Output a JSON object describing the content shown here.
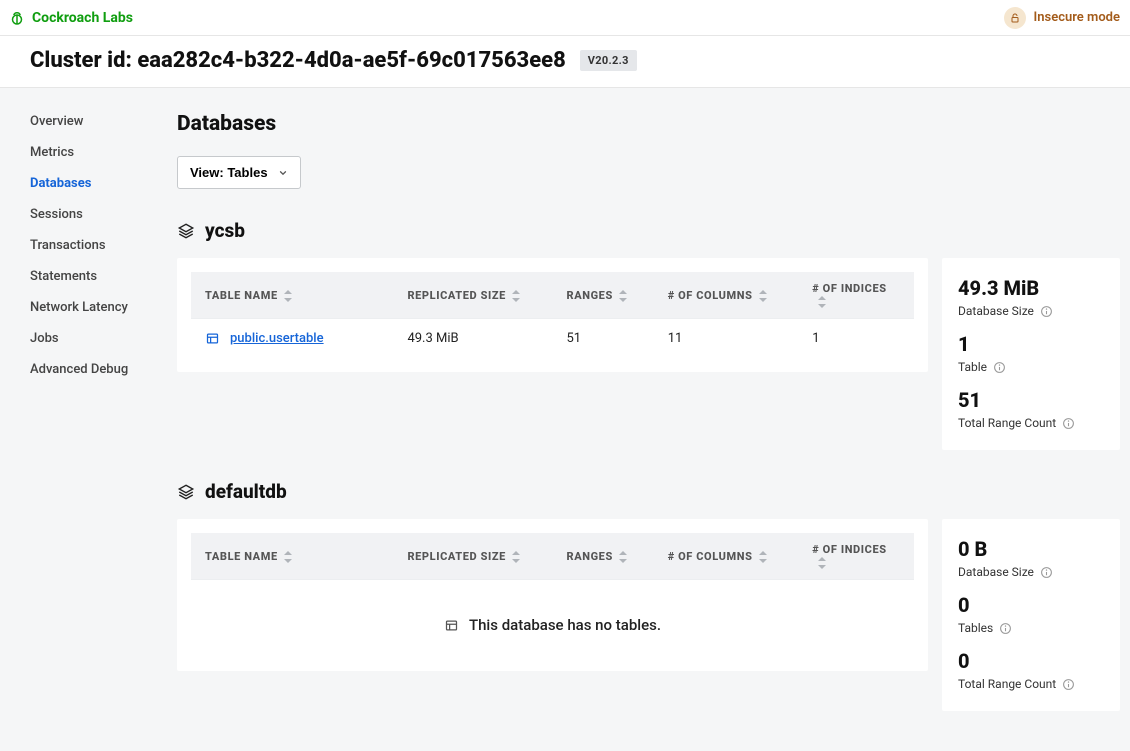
{
  "brand": "Cockroach Labs",
  "insecure_label": "Insecure mode",
  "cluster": {
    "prefix": "Cluster id: ",
    "id": "eaa282c4-b322-4d0a-ae5f-69c017563ee8",
    "version": "V20.2.3"
  },
  "sidebar": {
    "items": [
      {
        "label": "Overview"
      },
      {
        "label": "Metrics"
      },
      {
        "label": "Databases",
        "active": true
      },
      {
        "label": "Sessions"
      },
      {
        "label": "Transactions"
      },
      {
        "label": "Statements"
      },
      {
        "label": "Network Latency"
      },
      {
        "label": "Jobs"
      },
      {
        "label": "Advanced Debug"
      }
    ]
  },
  "page": {
    "title": "Databases",
    "view_button": "View: Tables"
  },
  "columns": {
    "name": "Table Name",
    "size": "Replicated Size",
    "ranges": "Ranges",
    "cols": "# of Columns",
    "indices": "# of Indices"
  },
  "stat_labels": {
    "db_size": "Database Size",
    "table": "Table",
    "tables": "Tables",
    "range_count": "Total Range Count"
  },
  "empty_msg": "This database has no tables.",
  "databases": [
    {
      "name": "ycsb",
      "tables": [
        {
          "name": "public.usertable",
          "size": "49.3 MiB",
          "ranges": "51",
          "cols": "11",
          "indices": "1"
        }
      ],
      "stats": {
        "size": "49.3 MiB",
        "table_count": "1",
        "table_label_key": "table",
        "range_count": "51"
      }
    },
    {
      "name": "defaultdb",
      "tables": [],
      "stats": {
        "size": "0 B",
        "table_count": "0",
        "table_label_key": "tables",
        "range_count": "0"
      }
    }
  ]
}
